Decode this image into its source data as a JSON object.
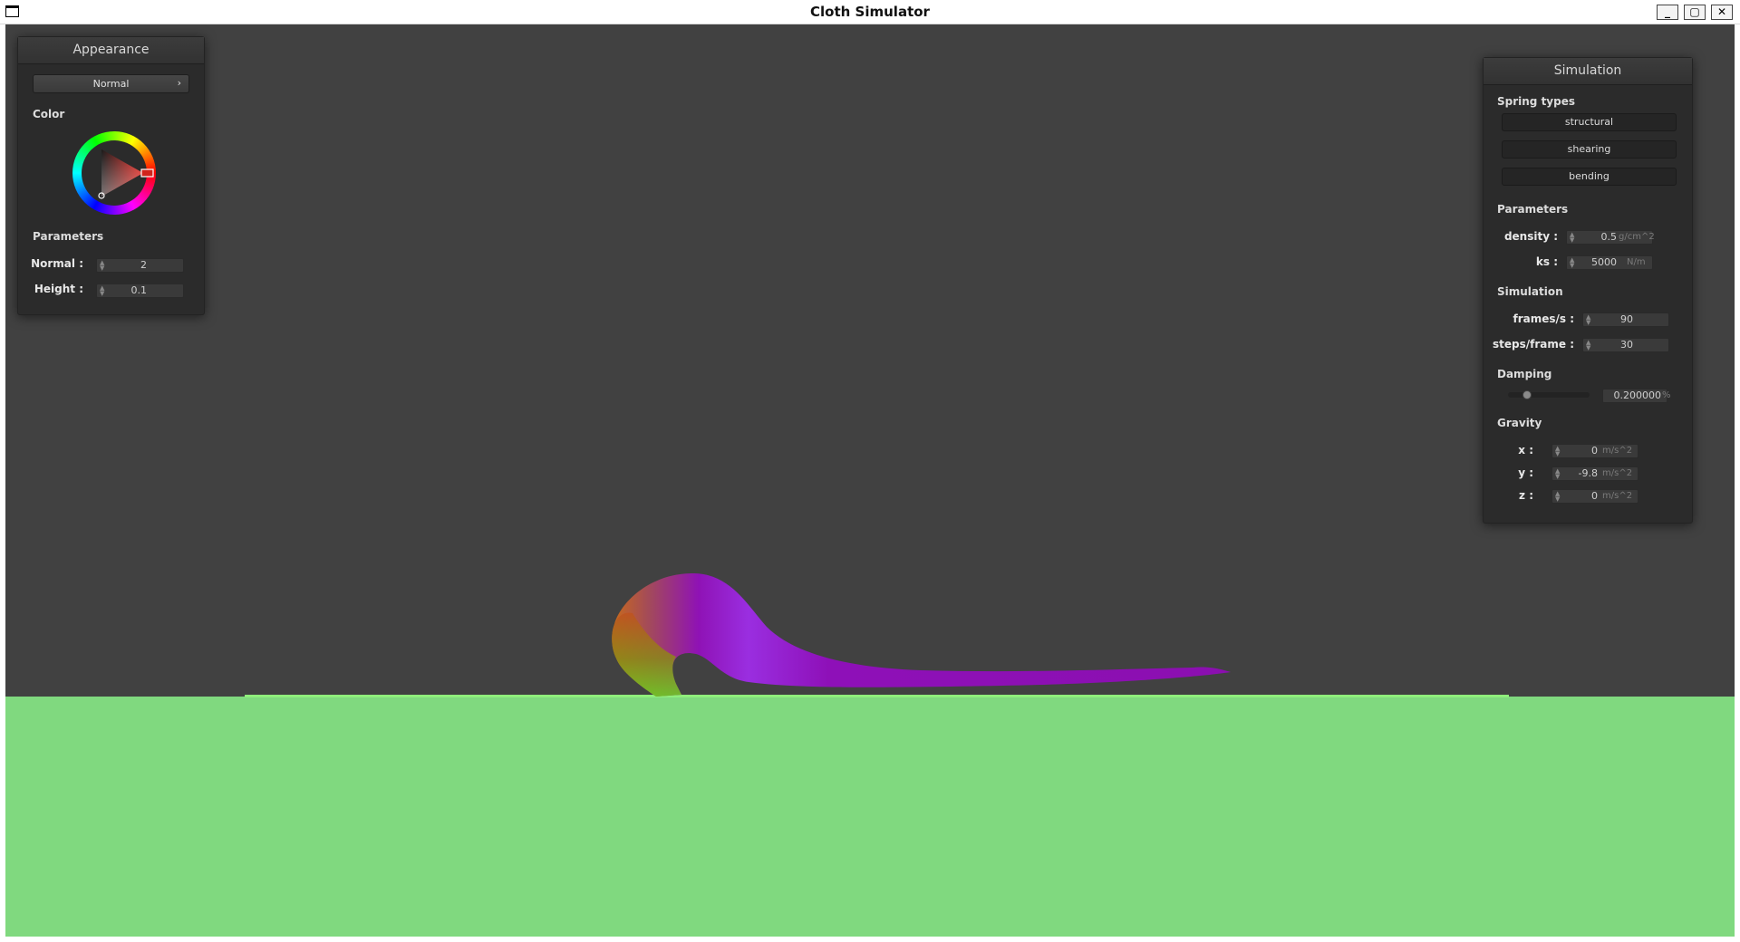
{
  "window": {
    "title": "Cloth Simulator"
  },
  "appearance": {
    "header": "Appearance",
    "mode": "Normal",
    "color_label": "Color",
    "selected_color": "#d0241c",
    "params_label": "Parameters",
    "normal_label": "Normal :",
    "normal_value": "2",
    "height_label": "Height :",
    "height_value": "0.1"
  },
  "simulation": {
    "header": "Simulation",
    "spring_types_label": "Spring types",
    "springs": [
      "structural",
      "shearing",
      "bending"
    ],
    "params_label": "Parameters",
    "density_label": "density :",
    "density_value": "0.5",
    "density_unit": "g/cm^2",
    "ks_label": "ks :",
    "ks_value": "5000",
    "ks_unit": "N/m",
    "sim_label": "Simulation",
    "fps_label": "frames/s :",
    "fps_value": "90",
    "steps_label": "steps/frame :",
    "steps_value": "30",
    "damping_label": "Damping",
    "damping_value": "0.200000",
    "damping_unit": "%",
    "damping_fraction": 0.2,
    "gravity_label": "Gravity",
    "gx_label": "x :",
    "gx_value": "0",
    "gy_label": "y :",
    "gy_value": "-9.8",
    "gz_label": "z :",
    "gz_value": "0",
    "gravity_unit": "m/s^2"
  },
  "scene": {
    "background_color": "#414141",
    "ground_color": "#80d97f",
    "cloth_color": "#9a14c8"
  }
}
